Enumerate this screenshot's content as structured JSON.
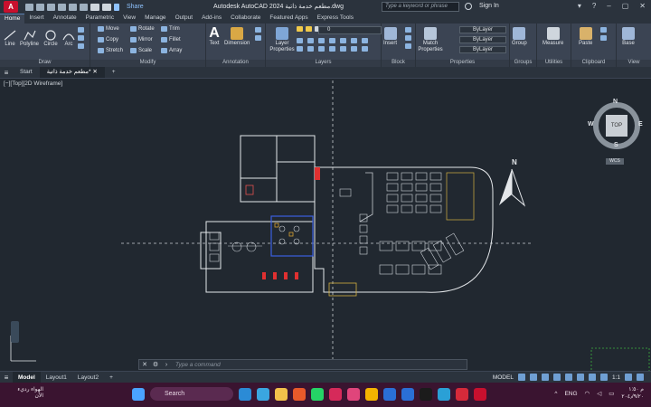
{
  "titlebar": {
    "app_logo": "A",
    "share_label": "Share",
    "window_title": "Autodesk AutoCAD 2024    مطعم خدمة ذاتية.dwg",
    "search_placeholder": "Type a keyword or phrase",
    "signin_label": "Sign In"
  },
  "ribbon_tabs": [
    "Home",
    "Insert",
    "Annotate",
    "Parametric",
    "View",
    "Manage",
    "Output",
    "Add-ins",
    "Collaborate",
    "Featured Apps",
    "Express Tools"
  ],
  "ribbon": {
    "draw": {
      "label": "Draw",
      "line": "Line",
      "polyline": "Polyline",
      "circle": "Circle",
      "arc": "Arc"
    },
    "modify": {
      "label": "Modify",
      "move": "Move",
      "rotate": "Rotate",
      "trim": "Trim",
      "copy": "Copy",
      "mirror": "Mirror",
      "fillet": "Fillet",
      "stretch": "Stretch",
      "scale": "Scale",
      "array": "Array"
    },
    "annotation": {
      "label": "Annotation",
      "text": "Text",
      "dimension": "Dimension"
    },
    "layers": {
      "label": "Layers",
      "layer_properties": "Layer Properties",
      "current_layer": "0"
    },
    "block": {
      "label": "Block",
      "insert": "Insert"
    },
    "properties": {
      "label": "Properties",
      "match": "Match Properties",
      "color": "ByLayer",
      "linetype": "ByLayer",
      "lineweight": "ByLayer"
    },
    "groups": {
      "label": "Groups",
      "group": "Group"
    },
    "utilities": {
      "label": "Utilities",
      "measure": "Measure"
    },
    "clipboard": {
      "label": "Clipboard",
      "paste": "Paste"
    },
    "view": {
      "label": "View",
      "base": "Base"
    }
  },
  "doc_tabs": {
    "start": "Start",
    "file": "مطعم خدمة ذاتية*",
    "add": "+"
  },
  "viewport": {
    "label": "[−][Top][2D Wireframe]",
    "viewcube": {
      "top": "TOP",
      "n": "N",
      "s": "S",
      "e": "E",
      "w": "W",
      "wcs": "WCS"
    },
    "north_label": "N"
  },
  "command_line": {
    "placeholder": "Type a command"
  },
  "layout_tabs": [
    "Model",
    "Layout1",
    "Layout2"
  ],
  "status": {
    "model": "MODEL",
    "scale": "1:1"
  },
  "taskbar": {
    "weather_line1": "الهواء رديء",
    "weather_line2": "الآن",
    "search_label": "Search",
    "lang": "ENG",
    "time": "م ١:٥٠",
    "date": "٢٠٤٫/٩/٢٠"
  }
}
